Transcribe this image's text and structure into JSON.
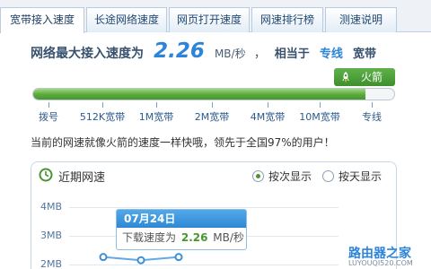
{
  "tabs": [
    {
      "label": "宽带接入速度",
      "active": true
    },
    {
      "label": "长途网络速度",
      "active": false
    },
    {
      "label": "网页打开速度",
      "active": false
    },
    {
      "label": "网速排行榜",
      "active": false
    },
    {
      "label": "测速说明",
      "active": false
    }
  ],
  "result": {
    "prefix": "网络最大接入速度为",
    "speed_value": "2.26",
    "speed_unit": "MB/秒",
    "separator": "，",
    "equal_text": "相当于",
    "level": "专线",
    "suffix": "宽带"
  },
  "badge": {
    "label": "火箭",
    "icon": "rocket-icon",
    "color": "#4b9531"
  },
  "progress": {
    "fraction": 0.92
  },
  "scale_ticks": [
    "拨号",
    "512K宽带",
    "1M宽带",
    "2M宽带",
    "4M宽带",
    "10M宽带",
    "专线"
  ],
  "comparison": "当前的网速就像火箭的速度一样快哦，领先于全国97%的用户！",
  "recent": {
    "title": "近期网速",
    "options": [
      {
        "label": "按次显示",
        "checked": true
      },
      {
        "label": "按天显示",
        "checked": false
      }
    ],
    "y_ticks": [
      "4MB",
      "3MB",
      "2MB"
    ],
    "tooltip": {
      "date": "07月24日",
      "label": "下载速度为",
      "value": "2.26",
      "unit": "MB/秒"
    }
  },
  "chart_data": {
    "type": "line",
    "series": [
      {
        "values": [
          2.26,
          2.15,
          2.26
        ]
      }
    ],
    "y_ticks": [
      "4MB",
      "3MB",
      "2MB"
    ],
    "ylim": [
      2,
      4
    ]
  },
  "watermark": {
    "main": "路由器之家",
    "sub": "LUYOUQI520.COM"
  },
  "colors": {
    "accent": "#2d84d8",
    "success": "#4b9531",
    "tab_border": "#b7cce0"
  }
}
